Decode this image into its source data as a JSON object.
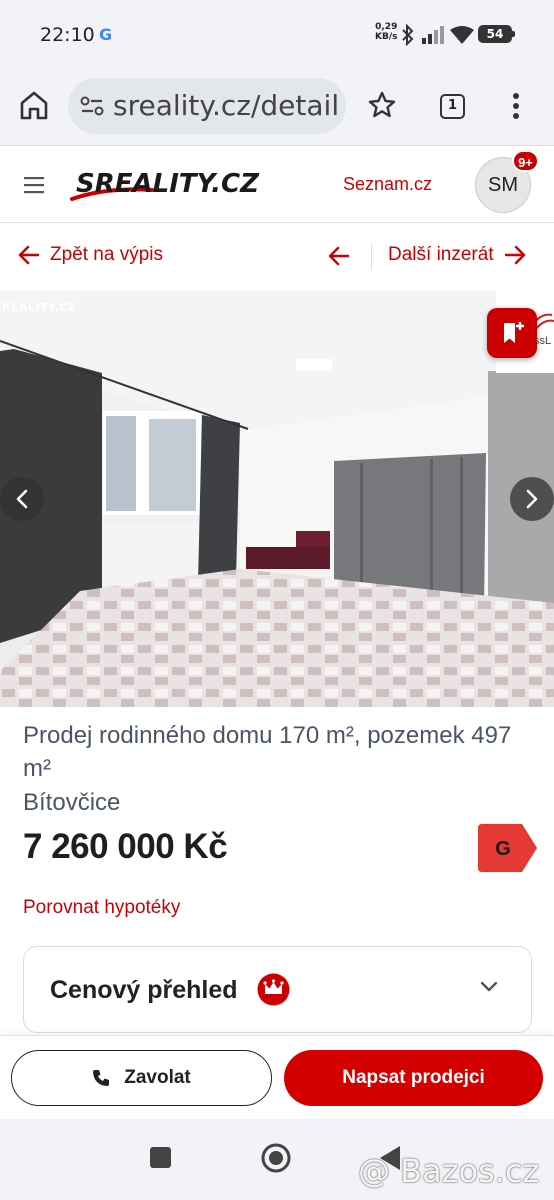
{
  "status_bar": {
    "time": "22:10",
    "google_indicator": "G",
    "net_speed_value": "0,29",
    "net_speed_unit": "KB/s",
    "battery": "54",
    "icons": [
      "bluetooth-icon",
      "signal-icon",
      "wifi-icon",
      "battery-icon"
    ]
  },
  "browser": {
    "url": "sreality.cz/detail",
    "tab_count": "1",
    "icons": [
      "home-icon",
      "site-settings-icon",
      "bookmark-star-icon",
      "tabs-icon",
      "more-vert-icon"
    ]
  },
  "header": {
    "logo_text": "SREALITY.CZ",
    "seznam_link": "Seznam.cz",
    "avatar_initials": "SM",
    "notification_count": "9+"
  },
  "nav": {
    "back_label": "Zpět na výpis",
    "next_label": "Další inzerát"
  },
  "gallery": {
    "watermark": "REALITY.CZ",
    "agency_text": "ssL"
  },
  "listing": {
    "title": "Prodej rodinného domu 170 m², pozemek 497 m²",
    "locality": "Bítovčice",
    "price": "7 260 000 Kč",
    "energy_class": "G",
    "mortgage_link": "Porovnat hypotéky",
    "price_overview_label": "Cenový přehled"
  },
  "actions": {
    "call_label": "Zavolat",
    "write_label": "Napsat prodejci"
  },
  "watermark_bottom": "@ Bazos.cz",
  "colors": {
    "brand_red": "#cc0000",
    "button_red": "#d40000",
    "energy_red": "#e53935",
    "text_gray": "#4a5566"
  }
}
